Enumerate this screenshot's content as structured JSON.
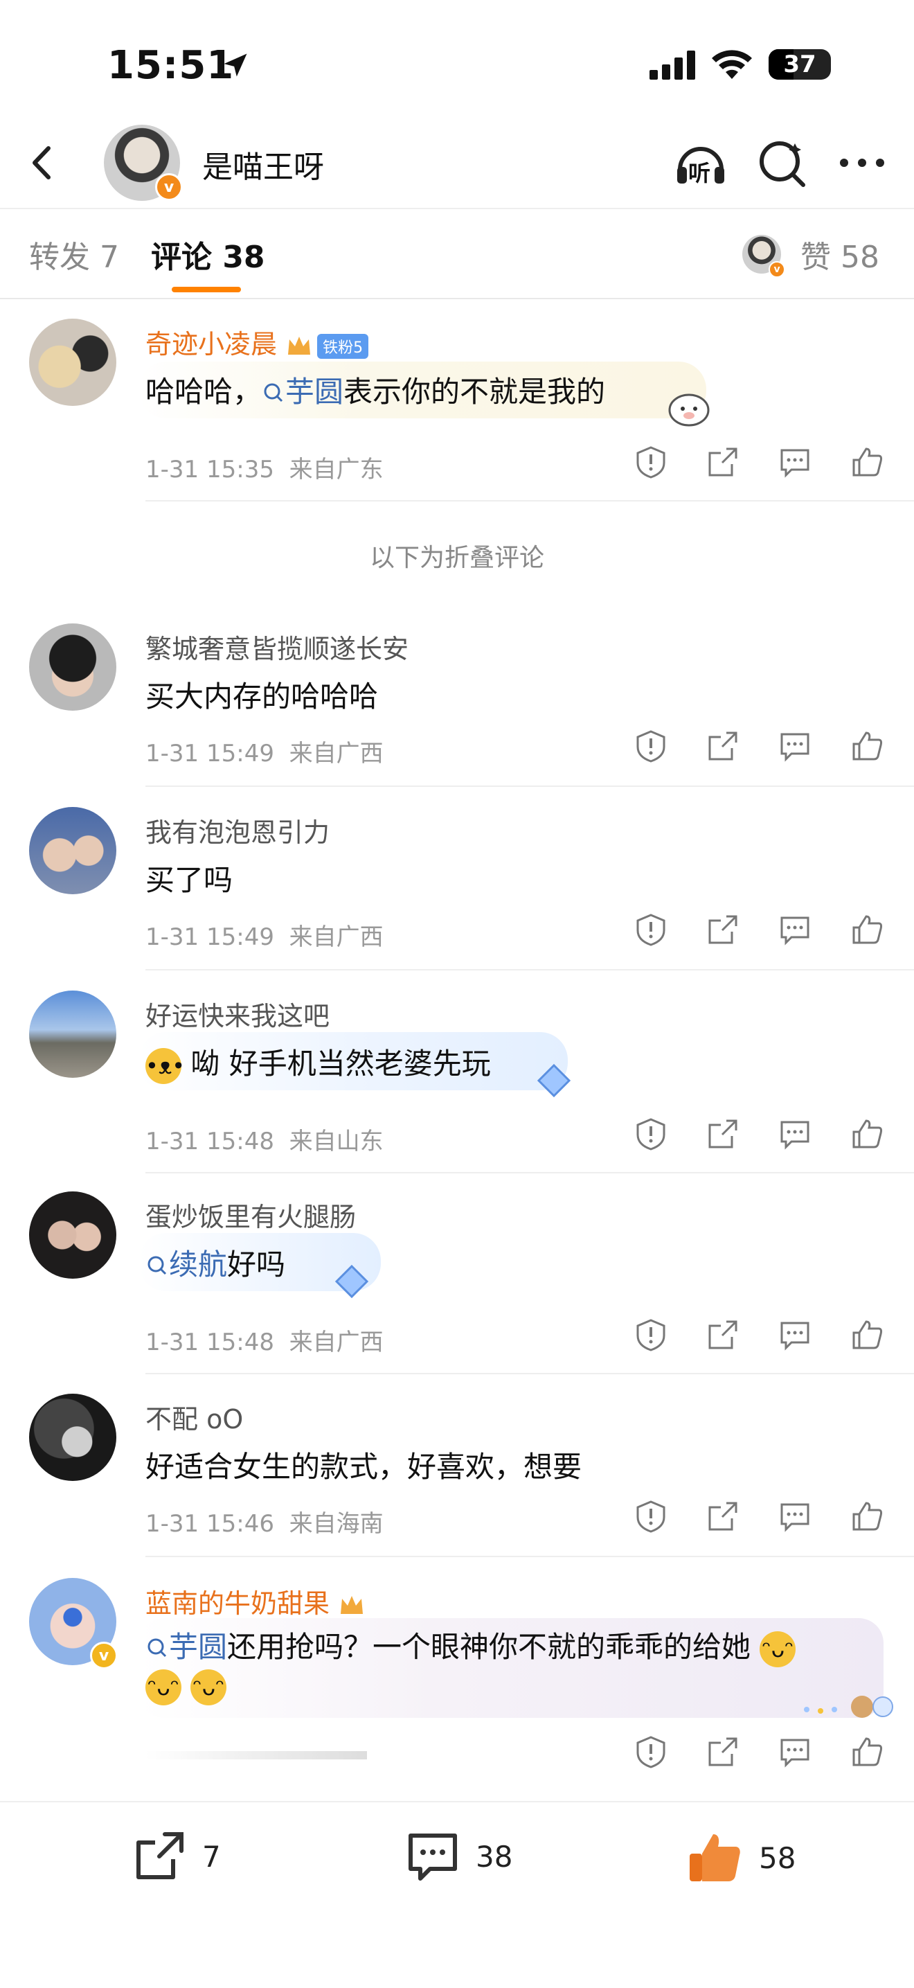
{
  "status_bar": {
    "time": "15:51",
    "battery": "37"
  },
  "header": {
    "title": "是喵王呀",
    "listen_label": "听"
  },
  "tabs": {
    "repost": "转发 7",
    "comments": "评论 38",
    "likes": "赞 58"
  },
  "fold_text": "以下为折叠评论",
  "comments": [
    {
      "name": "奇迹小凌晨",
      "fan_badge": "铁粉5",
      "text_prefix": "哈哈哈，",
      "link": "芋圆",
      "text_suffix": "表示你的不就是我的",
      "time": "1-31 15:35",
      "location": "来自广东"
    },
    {
      "name": "繁城奢意皆揽顺遂长安",
      "text": "买大内存的哈哈哈",
      "time": "1-31 15:49",
      "location": "来自广西"
    },
    {
      "name": "我有泡泡恩引力",
      "text": "买了吗",
      "time": "1-31 15:49",
      "location": "来自广西"
    },
    {
      "name": "好运快来我这吧",
      "text": "呦 好手机当然老婆先玩",
      "time": "1-31 15:48",
      "location": "来自山东"
    },
    {
      "name": "蛋炒饭里有火腿肠",
      "link": "续航",
      "text_suffix": "好吗",
      "time": "1-31 15:48",
      "location": "来自广西"
    },
    {
      "name": "不配 oO",
      "text": "好适合女生的款式，好喜欢，想要",
      "time": "1-31 15:46",
      "location": "来自海南"
    },
    {
      "name": "蓝南的牛奶甜果",
      "link": "芋圆",
      "text_suffix": "还用抢吗？一个眼神你不就的乖乖的给她"
    }
  ],
  "bottom_bar": {
    "repost_count": "7",
    "comment_count": "38",
    "like_count": "58"
  },
  "colors": {
    "accent": "#ff8200",
    "name_orange": "#e8711c",
    "link_blue": "#3b6bb3"
  }
}
